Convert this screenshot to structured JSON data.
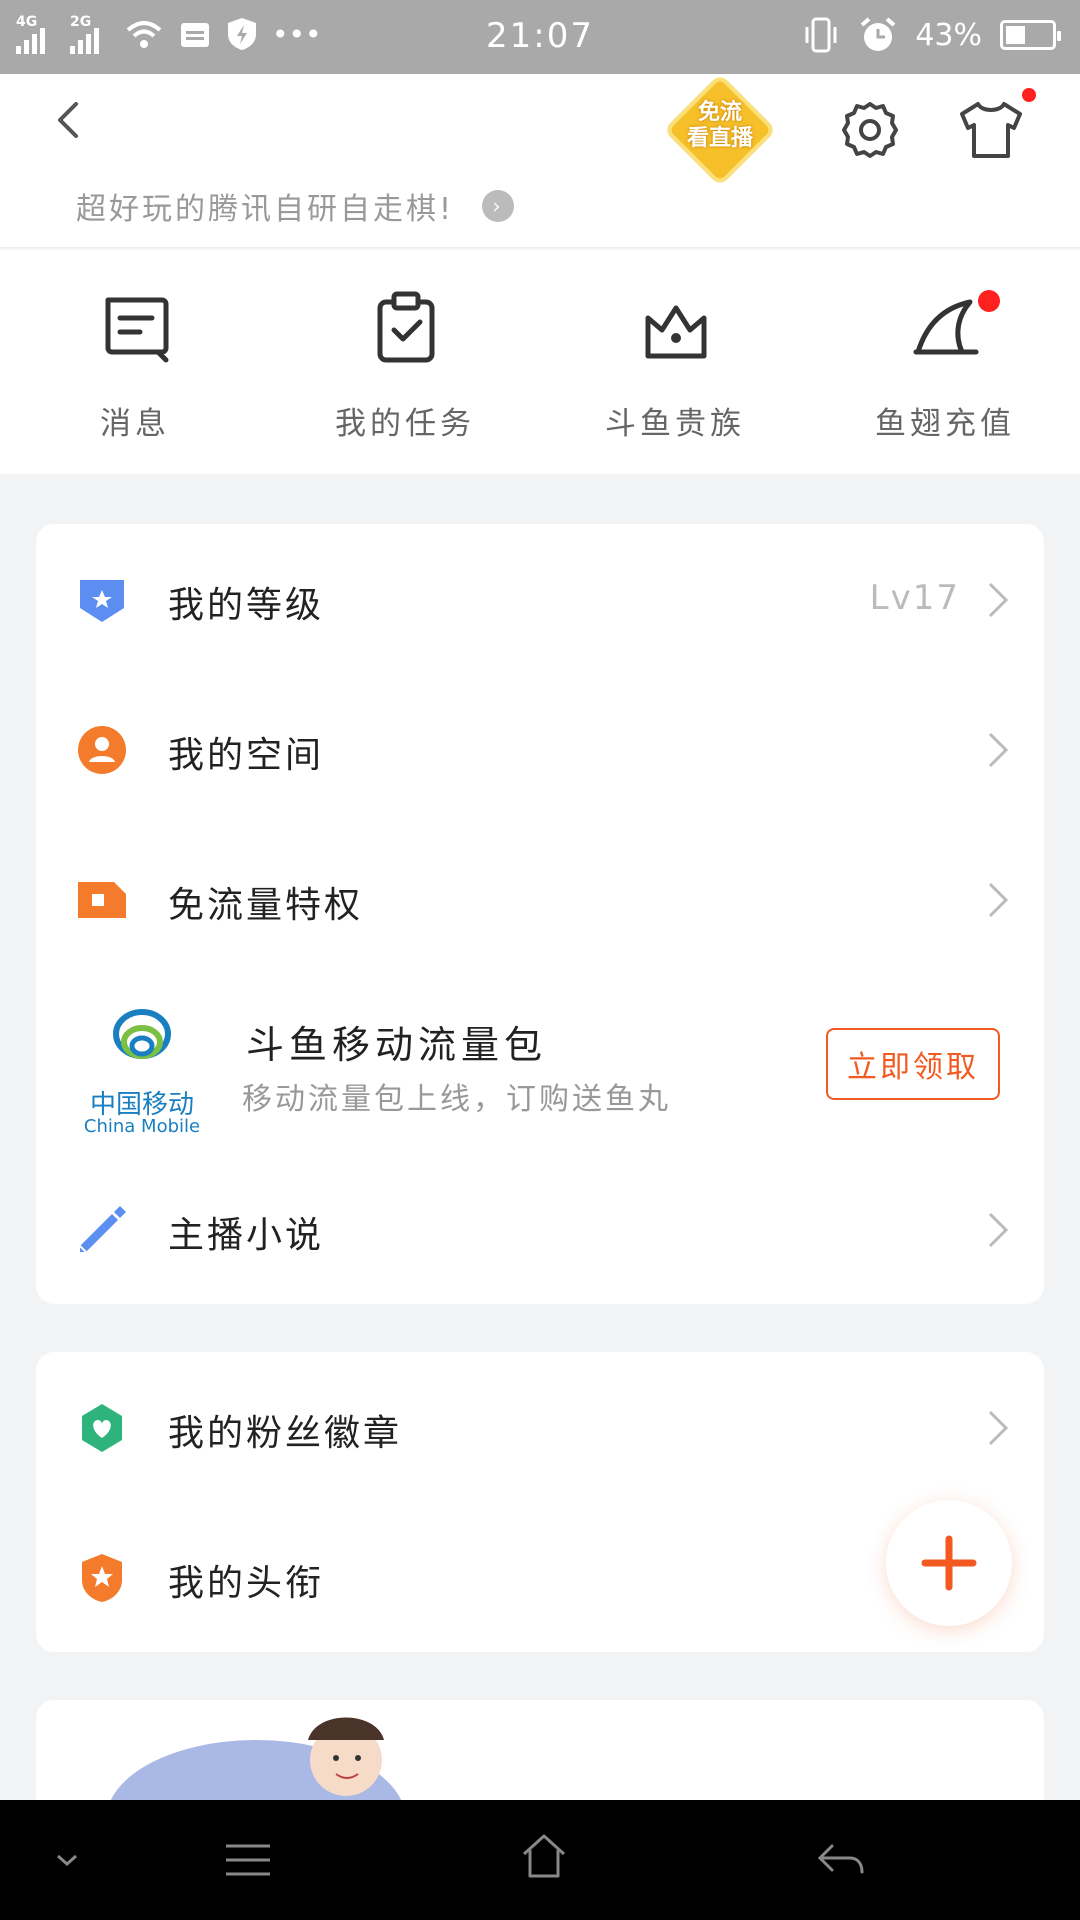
{
  "status_bar": {
    "network_1": "4G",
    "network_2": "2G",
    "time": "21:07",
    "battery_percent": "43%",
    "battery_level": 0.43
  },
  "header": {
    "promo_badge_line1": "免流",
    "promo_badge_line2": "看直播",
    "tagline": "超好玩的腾讯自研自走棋!",
    "tagline_arrow": "›"
  },
  "quick_actions": [
    {
      "label": "消息",
      "icon": "message-icon"
    },
    {
      "label": "我的任务",
      "icon": "task-clipboard-icon"
    },
    {
      "label": "斗鱼贵族",
      "icon": "crown-icon"
    },
    {
      "label": "鱼翅充值",
      "icon": "fin-icon",
      "has_dot": true
    }
  ],
  "menu_group_1": {
    "level": {
      "label": "我的等级",
      "value": "Lv17"
    },
    "space": {
      "label": "我的空间"
    },
    "free_data": {
      "label": "免流量特权"
    },
    "china_mobile": {
      "logo_cn": "中国移动",
      "logo_en": "China Mobile",
      "title": "斗鱼移动流量包",
      "subtitle": "移动流量包上线，订购送鱼丸",
      "button": "立即领取"
    },
    "novel": {
      "label": "主播小说"
    }
  },
  "menu_group_2": {
    "fan_badge": {
      "label": "我的粉丝徽章"
    },
    "title": {
      "label": "我的头衔"
    }
  },
  "colors": {
    "accent": "#f25a21",
    "blue_icon": "#5b8ef0",
    "orange_icon": "#f47b2b",
    "green_icon": "#2eb37c"
  }
}
